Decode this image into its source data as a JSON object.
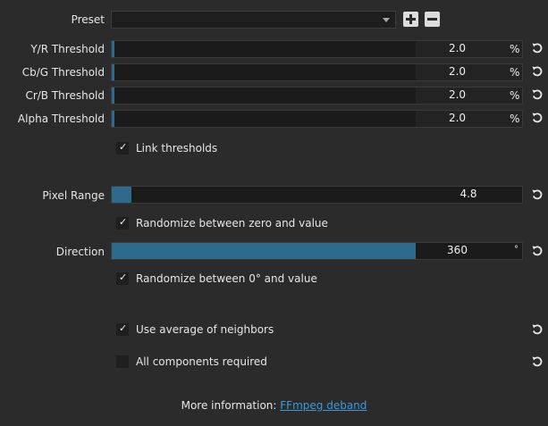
{
  "preset": {
    "label": "Preset",
    "value": ""
  },
  "thresholds": [
    {
      "label": "Y/R Threshold",
      "value": "2.0",
      "unit": "%"
    },
    {
      "label": "Cb/G Threshold",
      "value": "2.0",
      "unit": "%"
    },
    {
      "label": "Cr/B Threshold",
      "value": "2.0",
      "unit": "%"
    },
    {
      "label": "Alpha Threshold",
      "value": "2.0",
      "unit": "%"
    }
  ],
  "link_thresholds": {
    "label": "Link thresholds",
    "checked": true
  },
  "pixel_range": {
    "label": "Pixel Range",
    "value": "4.8"
  },
  "randomize_zero": {
    "label": "Randomize between zero and value",
    "checked": true
  },
  "direction": {
    "label": "Direction",
    "value": "360",
    "unit": "°"
  },
  "randomize_degree": {
    "label": "Randomize between 0° and value",
    "checked": true
  },
  "use_average": {
    "label": "Use average of neighbors",
    "checked": true
  },
  "all_components": {
    "label": "All components required",
    "checked": false
  },
  "info": {
    "prefix": "More information: ",
    "link_text": "FFmpeg deband"
  },
  "colors": {
    "accent": "#2e6a8c",
    "link": "#3a9ad9",
    "background": "#2b2b2b"
  },
  "icons": [
    "chevron-down-icon",
    "plus-icon",
    "minus-icon",
    "reset-icon",
    "checkmark-icon"
  ]
}
